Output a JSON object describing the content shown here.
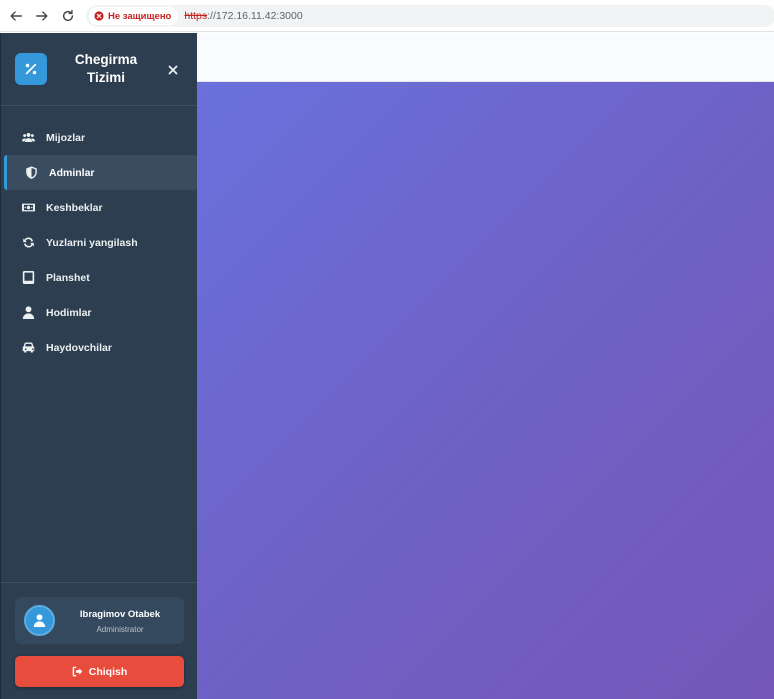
{
  "browser": {
    "security_label": "Не защищено",
    "url_scheme": "https",
    "url_rest": "://172.16.11.42:3000"
  },
  "sidebar": {
    "brand_line1": "Chegirma",
    "brand_line2": "Tizimi",
    "items": [
      {
        "label": "Mijozlar",
        "icon": "users-icon",
        "active": false
      },
      {
        "label": "Adminlar",
        "icon": "shield-icon",
        "active": true
      },
      {
        "label": "Keshbeklar",
        "icon": "money-icon",
        "active": false
      },
      {
        "label": "Yuzlarni yangilash",
        "icon": "refresh-icon",
        "active": false
      },
      {
        "label": "Planshet",
        "icon": "tablet-icon",
        "active": false
      },
      {
        "label": "Hodimlar",
        "icon": "user-icon",
        "active": false
      },
      {
        "label": "Haydovchilar",
        "icon": "car-icon",
        "active": false
      }
    ]
  },
  "user": {
    "name": "Ibragimov Otabek",
    "role": "Administrator"
  },
  "logout": {
    "label": "Chiqish"
  },
  "colors": {
    "sidebar_bg": "#2c3e50",
    "accent": "#3498db",
    "danger": "#e74c3c",
    "gradient_start": "#6a71dc",
    "gradient_end": "#7457b8"
  }
}
